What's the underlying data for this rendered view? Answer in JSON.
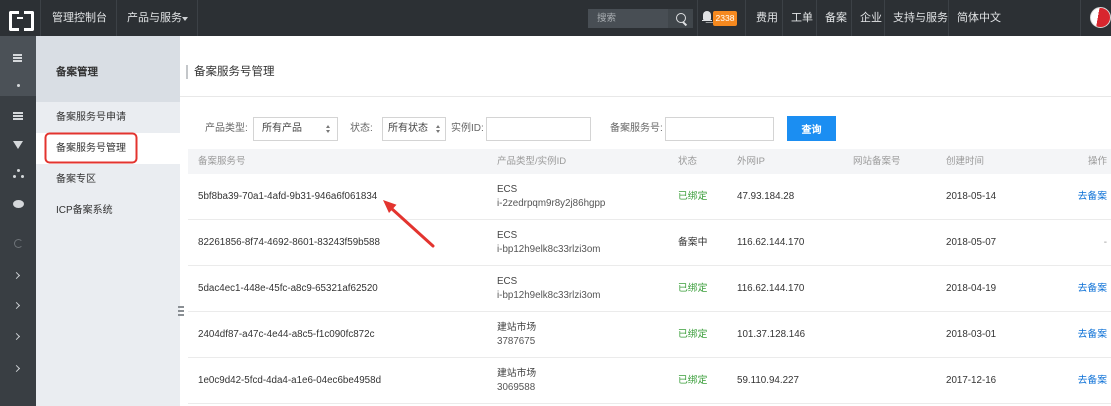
{
  "topbar": {
    "logo_icon": "aliyun-logo-icon",
    "console_label": "管理控制台",
    "products_label": "产品与服务",
    "products_caret_icon": "caret-down-icon",
    "search": {
      "placeholder": "搜索",
      "icon": "search-icon"
    },
    "notifications": {
      "icon": "bell-icon",
      "count": "2338"
    },
    "nav": [
      "费用",
      "工单",
      "备案",
      "企业",
      "支持与服务",
      "简体中文"
    ],
    "avatar_icon": "user-avatar"
  },
  "icon_rail": [
    "menu-icon",
    "dot-icon",
    "list-icon",
    "heart-icon",
    "cluster-icon",
    "cloud-icon",
    "link-icon",
    "chevron-right-icon",
    "chevron-right-icon",
    "chevron-right-icon",
    "chevron-right-icon"
  ],
  "sidebar": {
    "title": "备案管理",
    "items": [
      {
        "label": "备案服务号申请",
        "active": false
      },
      {
        "label": "备案服务号管理",
        "active": true
      },
      {
        "label": "备案专区",
        "active": false
      },
      {
        "label": "ICP备案系统",
        "active": false
      }
    ],
    "collapse_icon": "sidebar-collapse-icon"
  },
  "main": {
    "title": "备案服务号管理",
    "filters": {
      "product_type": {
        "label": "产品类型:",
        "value": "所有产品"
      },
      "status": {
        "label": "状态:",
        "value": "所有状态"
      },
      "instance_id": {
        "label": "实例ID:",
        "value": ""
      },
      "service_no": {
        "label": "备案服务号:",
        "value": ""
      },
      "select_arrow_icon": "sort-arrows-icon",
      "query_button": "查询"
    },
    "table": {
      "columns": [
        "备案服务号",
        "产品类型/实例ID",
        "状态",
        "外网IP",
        "网站备案号",
        "创建时间",
        "操作"
      ],
      "rows": [
        {
          "service_no": "5bf8ba39-70a1-4afd-9b31-946a6f061834",
          "product_type": "ECS",
          "instance_id": "i-2zedrpqm9r8y2j86hgpp",
          "status": "已绑定",
          "status_color": "#3a9e3a",
          "public_ip": "47.93.184.28",
          "website_record_no": "",
          "created": "2018-05-14",
          "action": "去备案",
          "action_color": "#0a6fd6"
        },
        {
          "service_no": "82261856-8f74-4692-8601-83243f59b588",
          "product_type": "ECS",
          "instance_id": "i-bp12h9elk8c33rlzi3om",
          "status": "备案中",
          "status_color": "#333333",
          "public_ip": "116.62.144.170",
          "website_record_no": "",
          "created": "2018-05-07",
          "action": "-",
          "action_color": "#999999"
        },
        {
          "service_no": "5dac4ec1-448e-45fc-a8c9-65321af62520",
          "product_type": "ECS",
          "instance_id": "i-bp12h9elk8c33rlzi3om",
          "status": "已绑定",
          "status_color": "#3a9e3a",
          "public_ip": "116.62.144.170",
          "website_record_no": "",
          "created": "2018-04-19",
          "action": "去备案",
          "action_color": "#0a6fd6"
        },
        {
          "service_no": "2404df87-a47c-4e44-a8c5-f1c090fc872c",
          "product_type": "建站市场",
          "instance_id": "3787675",
          "status": "已绑定",
          "status_color": "#3a9e3a",
          "public_ip": "101.37.128.146",
          "website_record_no": "",
          "created": "2018-03-01",
          "action": "去备案",
          "action_color": "#0a6fd6"
        },
        {
          "service_no": "1e0c9d42-5fcd-4da4-a1e6-04ec6be4958d",
          "product_type": "建站市场",
          "instance_id": "3069588",
          "status": "已绑定",
          "status_color": "#3a9e3a",
          "public_ip": "59.110.94.227",
          "website_record_no": "",
          "created": "2017-12-16",
          "action": "去备案",
          "action_color": "#0a6fd6"
        }
      ]
    }
  },
  "colors": {
    "topbar_bg": "#2c3034",
    "rail_bg": "#393e43",
    "sidebar_bg": "#eaedf1",
    "primary_button": "#1b8ef2",
    "link": "#0a6fd6",
    "status_bound": "#3a9e3a",
    "badge": "#f5891f",
    "annotation": "#e3342f"
  }
}
